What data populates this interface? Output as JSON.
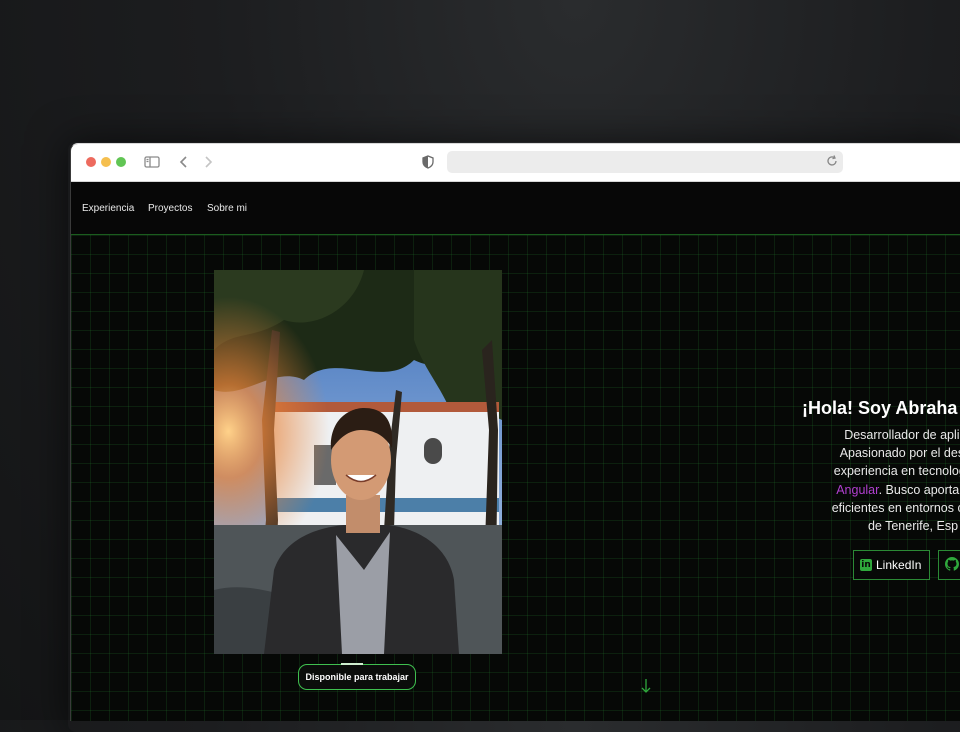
{
  "nav": {
    "items": [
      {
        "label": "Experiencia"
      },
      {
        "label": "Proyectos"
      },
      {
        "label": "Sobre mi"
      }
    ]
  },
  "hero": {
    "title": "¡Hola! Soy Abraha",
    "lines": [
      "Desarrollador de aplicaci",
      "Apasionado por el desarro",
      "experiencia en tecnologías c",
      "Angular",
      ". Busco aportar solu",
      "eficientes en entornos colabo",
      "de Tenerife, Esp"
    ],
    "buttons": {
      "linkedin": "LinkedIn"
    },
    "status_badge": "Disponible para trabajar"
  },
  "colors": {
    "accent": "#2fa83c",
    "highlight": "#b03fcf",
    "background": "#060806"
  },
  "icons": [
    "sidebar-icon",
    "back-arrow-icon",
    "forward-arrow-icon",
    "shield-icon",
    "reload-icon",
    "linkedin-icon",
    "github-icon",
    "down-arrow-icon"
  ]
}
